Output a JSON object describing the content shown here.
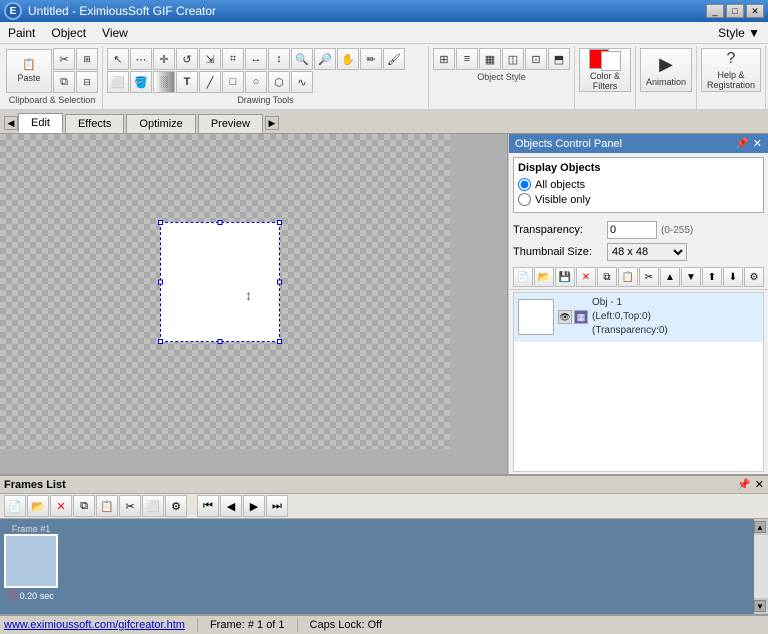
{
  "titlebar": {
    "title": "Untitled - EximiousSoft GIF Creator",
    "logo": "E",
    "controls": [
      "_",
      "□",
      "✕"
    ]
  },
  "menubar": {
    "items": [
      "Paint",
      "Object",
      "View"
    ]
  },
  "toolbar": {
    "sections": {
      "clipboard": {
        "label": "Clipboard & Selection"
      },
      "drawing": {
        "label": "Drawing Tools"
      },
      "object_style": {
        "label": "Object Style"
      },
      "color_filters": {
        "label": "Color & Filters"
      },
      "animation": {
        "label": "Animation"
      },
      "help": {
        "label": "Help & Registration"
      },
      "style": {
        "label": "Style ▼"
      }
    }
  },
  "tabs": {
    "items": [
      "Edit",
      "Effects",
      "Optimize",
      "Preview"
    ],
    "active": "Edit"
  },
  "objects_panel": {
    "title": "Objects Control Panel",
    "display_objects": {
      "title": "Display Objects",
      "options": [
        "All objects",
        "Visible only"
      ],
      "selected": "All objects"
    },
    "transparency": {
      "label": "Transparency:",
      "value": "0",
      "range": "(0-255)"
    },
    "thumbnail_size": {
      "label": "Thumbnail Size:",
      "value": "48 x 48"
    },
    "object": {
      "name": "Obj - 1",
      "details": "(Left:0,Top:0)",
      "transparency": "(Transparency:0)"
    }
  },
  "frames_panel": {
    "title": "Frames List",
    "frame": {
      "label": "Frame #1",
      "time": "0.20 sec"
    }
  },
  "statusbar": {
    "url": "www.eximioussoft.com/gifcreator.htm",
    "frame": "Frame: # 1 of 1",
    "capslock": "Caps Lock: Off"
  },
  "icons": {
    "paste": "📋",
    "cut": "✂",
    "copy": "⧉",
    "new": "📄",
    "open": "📂",
    "save": "💾",
    "undo": "↩",
    "redo": "↪",
    "select": "↖",
    "paint": "🖌",
    "fill": "🪣",
    "text": "T",
    "zoom_in": "🔍",
    "zoom_out": "🔎",
    "eye": "👁",
    "lock": "🔒",
    "color": "🎨",
    "gear": "⚙",
    "help": "?",
    "check": "✓",
    "x": "✕",
    "plus": "+",
    "minus": "-",
    "up": "▲",
    "down": "▼",
    "left": "◀",
    "right": "▶"
  }
}
